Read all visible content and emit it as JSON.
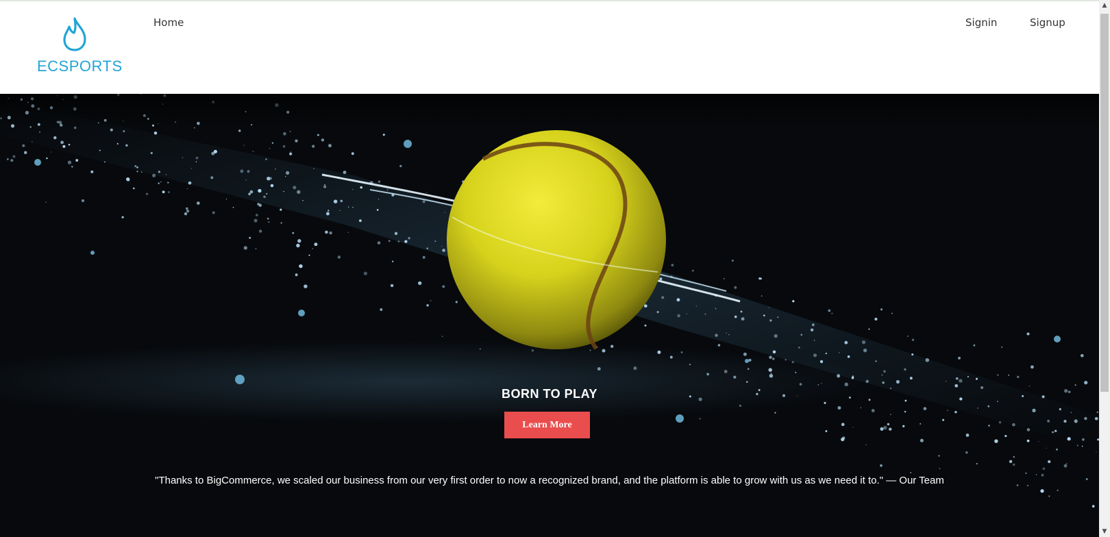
{
  "brand": {
    "name": "ECSPORTS",
    "icon": "flame-icon",
    "color": "#23a4d6"
  },
  "nav": {
    "home": "Home",
    "signin": "Signin",
    "signup": "Signup"
  },
  "hero": {
    "title": "BORN TO PLAY",
    "button_label": "Learn More",
    "button_color": "#ea4d4d",
    "quote": "\"Thanks to BigCommerce, we scaled our business from our very first order to now a recognized brand, and the platform is able to grow with us as we need it to.\" — Our Team",
    "image": "tennis-ball-water-splash"
  },
  "scrollbar": {
    "up_icon": "scroll-up-arrow-icon",
    "down_icon": "scroll-down-arrow-icon"
  }
}
